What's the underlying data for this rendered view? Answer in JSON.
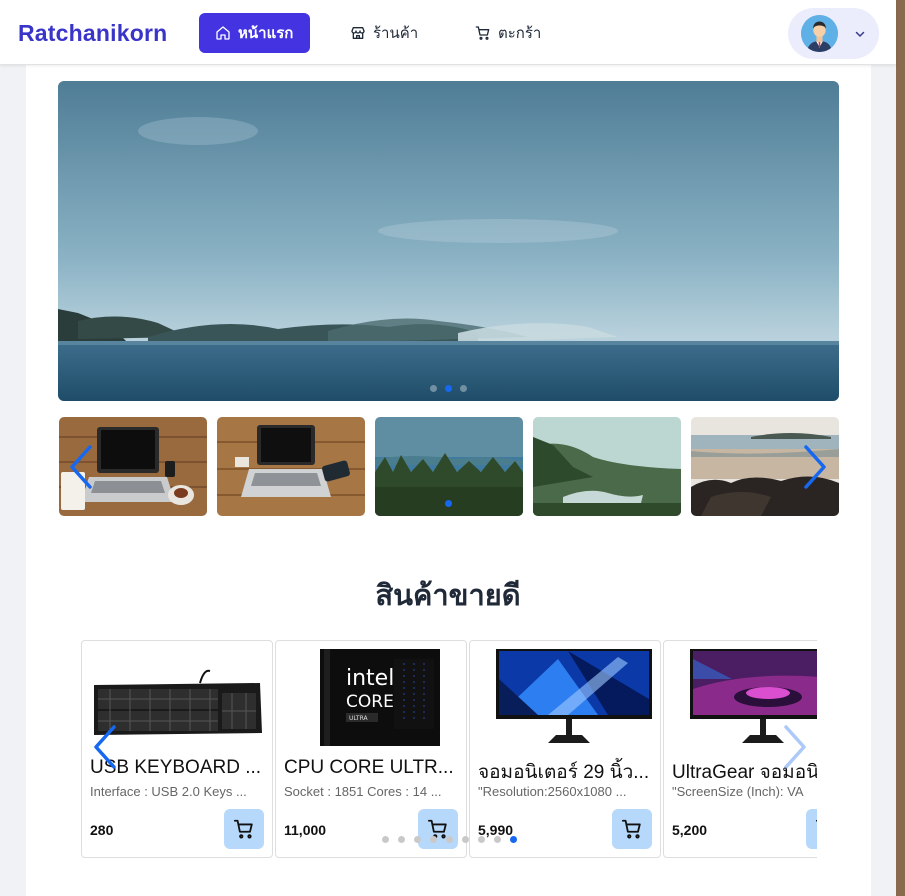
{
  "nav": {
    "brand": "Ratchanikorn",
    "home": "หน้าแรก",
    "store": "ร้านค้า",
    "cart": "ตะกร้า"
  },
  "hero": {
    "slide_count": 1,
    "active_slide": 1
  },
  "thumbnails": [
    {
      "name": "laptop-desk"
    },
    {
      "name": "laptop-phone"
    },
    {
      "name": "forest-lake"
    },
    {
      "name": "river-valley"
    },
    {
      "name": "beach-rocks"
    }
  ],
  "bestsellers": {
    "title": "สินค้าขายดี",
    "products": [
      {
        "name": "USB KEYBOARD ...",
        "desc": "Interface : USB 2.0 Keys ...",
        "price": "280"
      },
      {
        "name": "CPU CORE ULTR...",
        "desc": "Socket : 1851 Cores : 14 ...",
        "price": "11,000"
      },
      {
        "name": "จอมอนิเตอร์ 29 นิ้ว...",
        "desc": "\"Resolution:2560x1080 ...",
        "price": "5,990"
      },
      {
        "name": "UltraGear จอมอนิ",
        "desc": "\"ScreenSize (Inch): VA",
        "price": "5,200"
      }
    ],
    "dot_count": 8,
    "active_dot": 8
  },
  "colors": {
    "brand": "#3a35c9",
    "primary": "#4333e0",
    "accent_blue": "#1668f0",
    "cart_button": "#b6d8fa"
  }
}
